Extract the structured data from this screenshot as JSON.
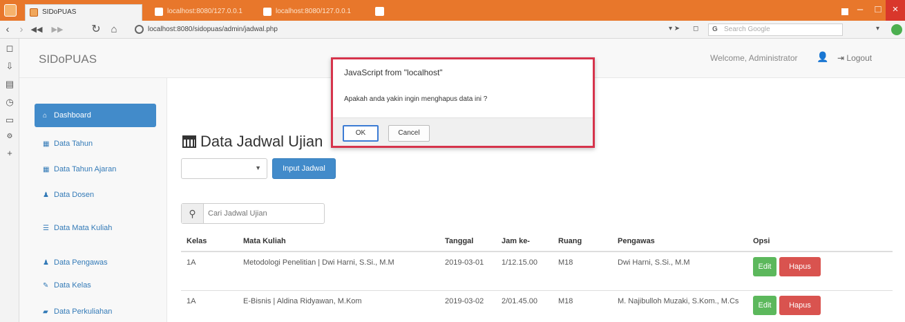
{
  "browser": {
    "tabs": [
      {
        "label": "SIDoPUAS",
        "active": true
      },
      {
        "label": "localhost:8080/127.0.0.1",
        "active": false
      },
      {
        "label": "localhost:8080/127.0.0.1",
        "active": false
      }
    ],
    "url": "localhost:8080/sidopuas/admin/jadwal.php",
    "search_placeholder": "Search Google"
  },
  "app": {
    "brand": "SIDoPUAS",
    "welcome": "Welcome, Administrator",
    "logout": "Logout"
  },
  "sidebar": {
    "items": [
      {
        "label": "Dashboard",
        "icon": "home-icon",
        "active": true
      },
      {
        "label": "Data Tahun",
        "icon": "grid-icon"
      },
      {
        "label": "Data Tahun Ajaran",
        "icon": "grid-icon"
      },
      {
        "label": "Data Dosen",
        "icon": "user-icon"
      },
      {
        "label": "Data Mata Kuliah",
        "icon": "list-icon"
      },
      {
        "label": "Data Pengawas",
        "icon": "user-icon"
      },
      {
        "label": "Data Kelas",
        "icon": "wrench-icon"
      },
      {
        "label": "Data Perkuliahan",
        "icon": "book-icon"
      }
    ]
  },
  "main": {
    "title": "Data Jadwal Ujian",
    "input_button": "Input Jadwal",
    "search_placeholder": "Cari Jadwal Ujian"
  },
  "table": {
    "headers": [
      "Kelas",
      "Mata Kuliah",
      "Tanggal",
      "Jam ke-",
      "Ruang",
      "Pengawas",
      "Opsi"
    ],
    "rows": [
      {
        "kelas": "1A",
        "mata_kuliah": "Metodologi Penelitian | Dwi Harni, S.Si., M.M",
        "tanggal": "2019-03-01",
        "jam": "1/12.15.00",
        "ruang": "M18",
        "pengawas": "Dwi Harni, S.Si., M.M"
      },
      {
        "kelas": "1A",
        "mata_kuliah": "E-Bisnis | Aldina Ridyawan, M.Kom",
        "tanggal": "2019-03-02",
        "jam": "2/01.45.00",
        "ruang": "M18",
        "pengawas": "M. Najibulloh Muzaki, S.Kom., M.Cs"
      }
    ],
    "edit_label": "Edit",
    "hapus_label": "Hapus"
  },
  "dialog": {
    "title": "JavaScript from \"localhost\"",
    "message": "Apakah anda yakin ingin menghapus data ini ?",
    "ok": "OK",
    "cancel": "Cancel"
  },
  "colors": {
    "titlebar": "#e8772b",
    "primary": "#428bca",
    "success": "#5cb85c",
    "danger": "#d9534f",
    "dialog_border": "#d6334b"
  }
}
